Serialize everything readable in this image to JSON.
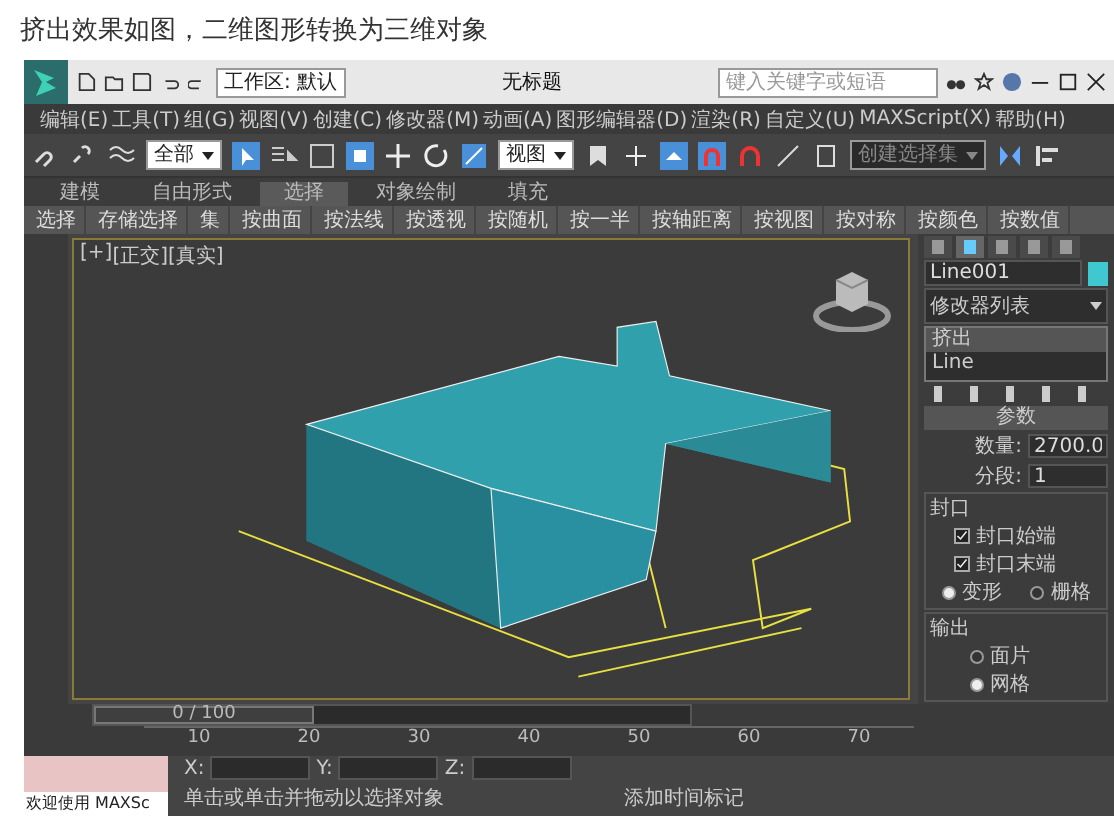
{
  "caption": "挤出效果如图，二维图形转换为三维对象",
  "window": {
    "workspace": "工作区: 默认",
    "title": "无标题",
    "search": {
      "placeholder": "键入关键字或短语"
    }
  },
  "menu": [
    "编辑(E)",
    "工具(T)",
    "组(G)",
    "视图(V)",
    "创建(C)",
    "修改器(M)",
    "动画(A)",
    "图形编辑器(D)",
    "渲染(R)",
    "自定义(U)",
    "MAXScript(X)",
    "帮助(H)"
  ],
  "toolbar": {
    "filter": "全部",
    "coordinate": "视图",
    "selection_set": {
      "placeholder": "创建选择集"
    }
  },
  "ribbon_tabs": [
    {
      "label": "建模",
      "selected": false
    },
    {
      "label": "自由形式",
      "selected": false
    },
    {
      "label": "选择",
      "selected": true
    },
    {
      "label": "对象绘制",
      "selected": false
    },
    {
      "label": "填充",
      "selected": false
    }
  ],
  "ribbon_tools": [
    "选择",
    "存储选择",
    "集",
    "按曲面",
    "按法线",
    "按透视",
    "按随机",
    "按一半",
    "按轴距离",
    "按视图",
    "按对称",
    "按颜色",
    "按数值"
  ],
  "viewport": {
    "labels": [
      "[+]",
      "[正交]",
      "[真实]"
    ]
  },
  "command_panel": {
    "object_name": "Line001",
    "modifier_list": "修改器列表",
    "stack": [
      {
        "label": "挤出",
        "selected": true
      },
      {
        "label": "Line",
        "selected": false
      }
    ],
    "rollout": "参数",
    "amount": {
      "label": "数量:",
      "value": "2700.0"
    },
    "segments": {
      "label": "分段:",
      "value": "1"
    },
    "capping": {
      "title": "封口",
      "options": [
        {
          "label": "封口始端",
          "checked": true
        },
        {
          "label": "封口末端",
          "checked": true
        }
      ],
      "type": [
        {
          "label": "变形",
          "selected": true
        },
        {
          "label": "栅格",
          "selected": false
        }
      ]
    },
    "output": {
      "title": "输出",
      "options": [
        {
          "label": "面片",
          "selected": false
        },
        {
          "label": "网格",
          "selected": true
        }
      ]
    }
  },
  "timeline": {
    "frame": "0 / 100",
    "ticks": [
      "10",
      "20",
      "30",
      "40",
      "50",
      "60",
      "70"
    ]
  },
  "status": {
    "script_listener": "欢迎使用 MAXSc",
    "prompt": "单击或单击并拖动以选择对象",
    "coords": [
      "X:",
      "Y:",
      "Z:"
    ],
    "time_tag": "添加时间标记"
  }
}
